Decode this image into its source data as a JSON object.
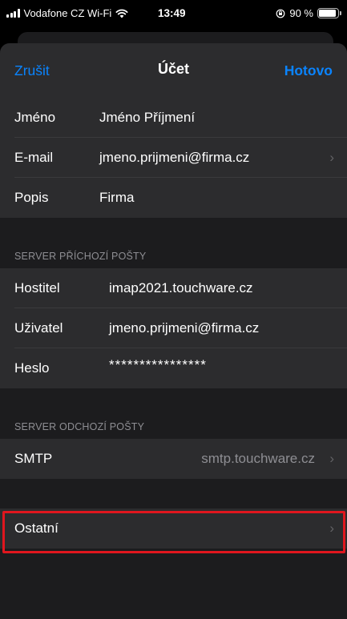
{
  "status_bar": {
    "carrier": "Vodafone CZ Wi-Fi",
    "time": "13:49",
    "battery": "90 %",
    "battery_level": 0.9
  },
  "navbar": {
    "cancel": "Zrušit",
    "title": "Účet",
    "done": "Hotovo"
  },
  "account": {
    "name_label": "Jméno",
    "name_value": "Jméno Příjmení",
    "email_label": "E-mail",
    "email_value": "jmeno.prijmeni@firma.cz",
    "description_label": "Popis",
    "description_value": "Firma"
  },
  "incoming": {
    "header": "SERVER PŘÍCHOZÍ POŠTY",
    "host_label": "Hostitel",
    "host_value": "imap2021.touchware.cz",
    "user_label": "Uživatel",
    "user_value": "jmeno.prijmeni@firma.cz",
    "password_label": "Heslo",
    "password_value": "****************"
  },
  "outgoing": {
    "header": "SERVER ODCHOZÍ POŠTY",
    "smtp_label": "SMTP",
    "smtp_value": "smtp.touchware.cz"
  },
  "other": {
    "label": "Ostatní"
  },
  "colors": {
    "accent": "#0a84ff",
    "highlight": "#e0161e"
  }
}
